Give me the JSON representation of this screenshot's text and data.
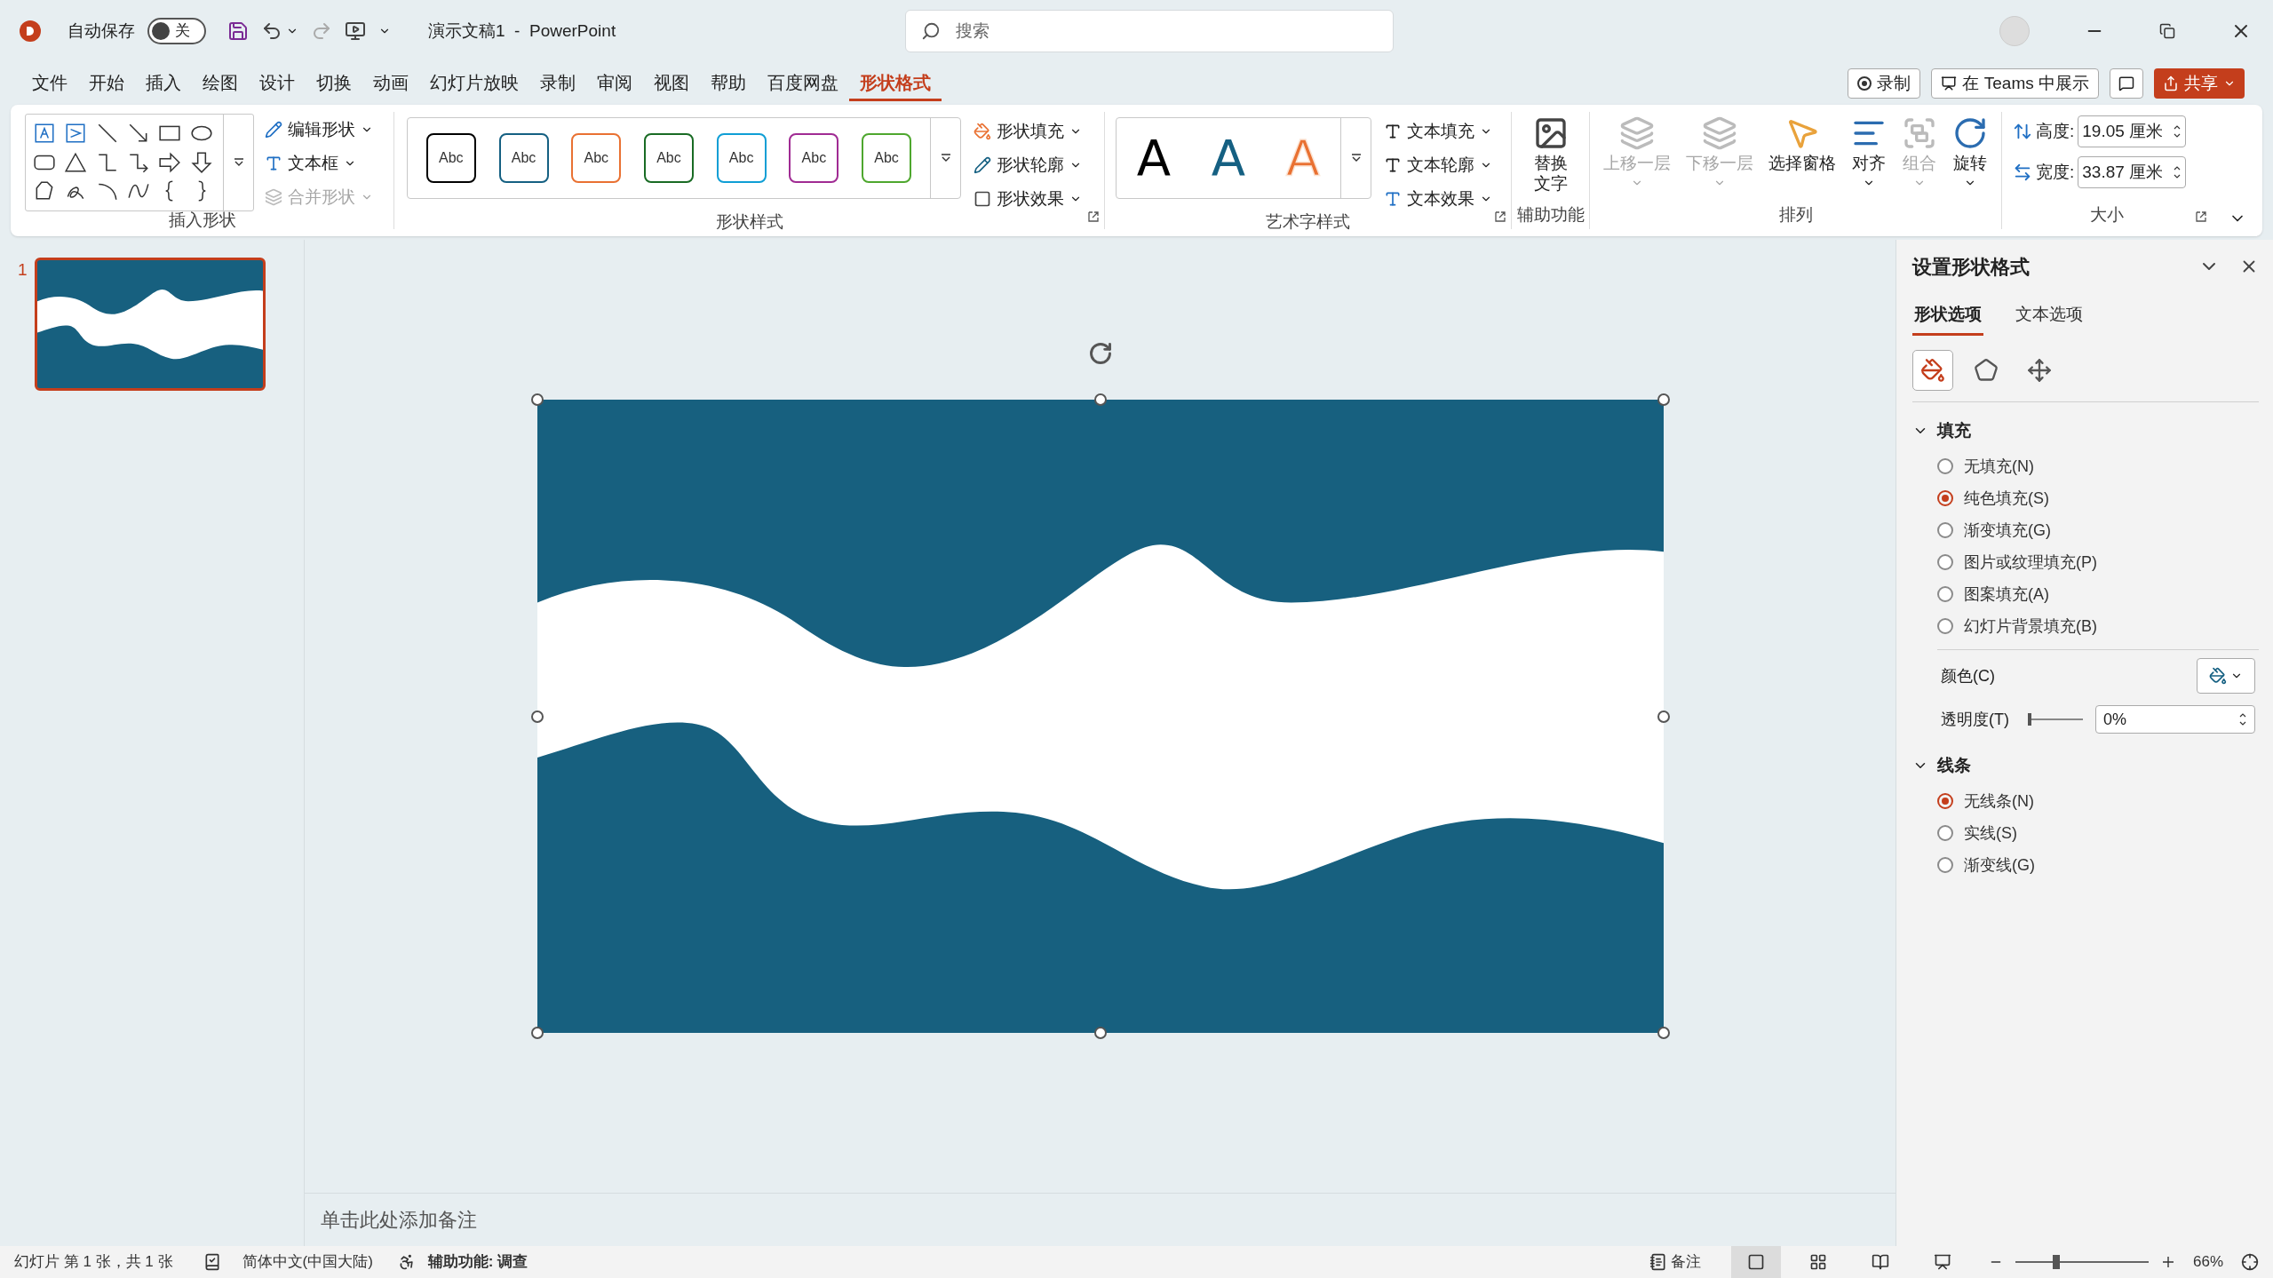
{
  "title_bar": {
    "autosave_label": "自动保存",
    "autosave": {
      "on": false,
      "label": "关"
    },
    "document_title": "演示文稿1  -  PowerPoint",
    "search": {
      "placeholder": "搜索"
    }
  },
  "menu_tabs": [
    {
      "label": "文件",
      "selected": false
    },
    {
      "label": "开始",
      "selected": false
    },
    {
      "label": "插入",
      "selected": false
    },
    {
      "label": "绘图",
      "selected": false
    },
    {
      "label": "设计",
      "selected": false
    },
    {
      "label": "切换",
      "selected": false
    },
    {
      "label": "动画",
      "selected": false
    },
    {
      "label": "幻灯片放映",
      "selected": false
    },
    {
      "label": "录制",
      "selected": false
    },
    {
      "label": "审阅",
      "selected": false
    },
    {
      "label": "视图",
      "selected": false
    },
    {
      "label": "帮助",
      "selected": false
    },
    {
      "label": "百度网盘",
      "selected": false
    },
    {
      "label": "形状格式",
      "selected": true
    }
  ],
  "ribbon_actions": {
    "record": "录制",
    "teams": "在 Teams 中展示",
    "share": "共享"
  },
  "ribbon": {
    "insert_shapes": {
      "label": "插入形状",
      "commands": [
        {
          "label": "编辑形状",
          "disabled": false
        },
        {
          "label": "文本框",
          "disabled": false
        },
        {
          "label": "合并形状",
          "disabled": true
        }
      ]
    },
    "shape_styles": {
      "label": "形状样式",
      "presets": [
        {
          "sample": "Abc",
          "color": "#000000"
        },
        {
          "sample": "Abc",
          "color": "#156082"
        },
        {
          "sample": "Abc",
          "color": "#e97132"
        },
        {
          "sample": "Abc",
          "color": "#196b24"
        },
        {
          "sample": "Abc",
          "color": "#0f9ed5"
        },
        {
          "sample": "Abc",
          "color": "#a02b93"
        },
        {
          "sample": "Abc",
          "color": "#4ea72e"
        }
      ],
      "commands": [
        {
          "label": "形状填充"
        },
        {
          "label": "形状轮廓"
        },
        {
          "label": "形状效果"
        }
      ]
    },
    "wordart_styles": {
      "label": "艺术字样式",
      "presets": [
        {
          "sample": "A",
          "kind": "solid",
          "color": "#000000"
        },
        {
          "sample": "A",
          "kind": "solid",
          "color": "#156082"
        },
        {
          "sample": "A",
          "kind": "outlined",
          "color": "#e97132"
        }
      ],
      "commands": [
        {
          "label": "文本填充"
        },
        {
          "label": "文本轮廓"
        },
        {
          "label": "文本效果"
        }
      ]
    },
    "accessibility": {
      "label": "辅助功能",
      "command_lines": [
        "替换",
        "文字"
      ]
    },
    "arrange": {
      "label": "排列",
      "commands": [
        {
          "label": "上移一层",
          "disabled": true,
          "dropdown": true
        },
        {
          "label": "下移一层",
          "disabled": true,
          "dropdown": true
        },
        {
          "label": "选择窗格",
          "disabled": false,
          "dropdown": false
        },
        {
          "label": "对齐",
          "disabled": false,
          "dropdown": true
        },
        {
          "label": "组合",
          "disabled": true,
          "dropdown": true
        },
        {
          "label": "旋转",
          "disabled": false,
          "dropdown": true
        }
      ]
    },
    "size": {
      "label": "大小",
      "fields": [
        {
          "label": "高度:",
          "value": "19.05 厘米"
        },
        {
          "label": "宽度:",
          "value": "33.87 厘米"
        }
      ]
    }
  },
  "slides": [
    {
      "number": "1",
      "selected": true
    }
  ],
  "notes": {
    "placeholder": "单击此处添加备注"
  },
  "format_pane": {
    "title": "设置形状格式",
    "tabs": [
      {
        "label": "形状选项",
        "selected": true
      },
      {
        "label": "文本选项",
        "selected": false
      }
    ],
    "icon_tabs": [
      {
        "selected": true
      },
      {
        "selected": false
      },
      {
        "selected": false
      }
    ],
    "fill": {
      "title": "填充",
      "expanded": true,
      "options": [
        {
          "label": "无填充(N)",
          "selected": false
        },
        {
          "label": "纯色填充(S)",
          "selected": true
        },
        {
          "label": "渐变填充(G)",
          "selected": false
        },
        {
          "label": "图片或纹理填充(P)",
          "selected": false
        },
        {
          "label": "图案填充(A)",
          "selected": false
        },
        {
          "label": "幻灯片背景填充(B)",
          "selected": false
        }
      ],
      "color_label": "颜色(C)",
      "transparency": {
        "label": "透明度(T)",
        "level": 0,
        "value": "0%"
      }
    },
    "line": {
      "title": "线条",
      "expanded": true,
      "options": [
        {
          "label": "无线条(N)",
          "selected": true
        },
        {
          "label": "实线(S)",
          "selected": false
        },
        {
          "label": "渐变线(G)",
          "selected": false
        }
      ]
    }
  },
  "status_bar": {
    "slide_info": "幻灯片 第 1 张，共 1 张",
    "language": "简体中文(中国大陆)",
    "accessibility": "辅助功能: 调查",
    "notes": "备注",
    "views": [
      {
        "selected": true
      },
      {
        "selected": false
      },
      {
        "selected": false
      },
      {
        "selected": false
      }
    ],
    "zoom": {
      "level": 0.31,
      "value": "66%"
    }
  }
}
